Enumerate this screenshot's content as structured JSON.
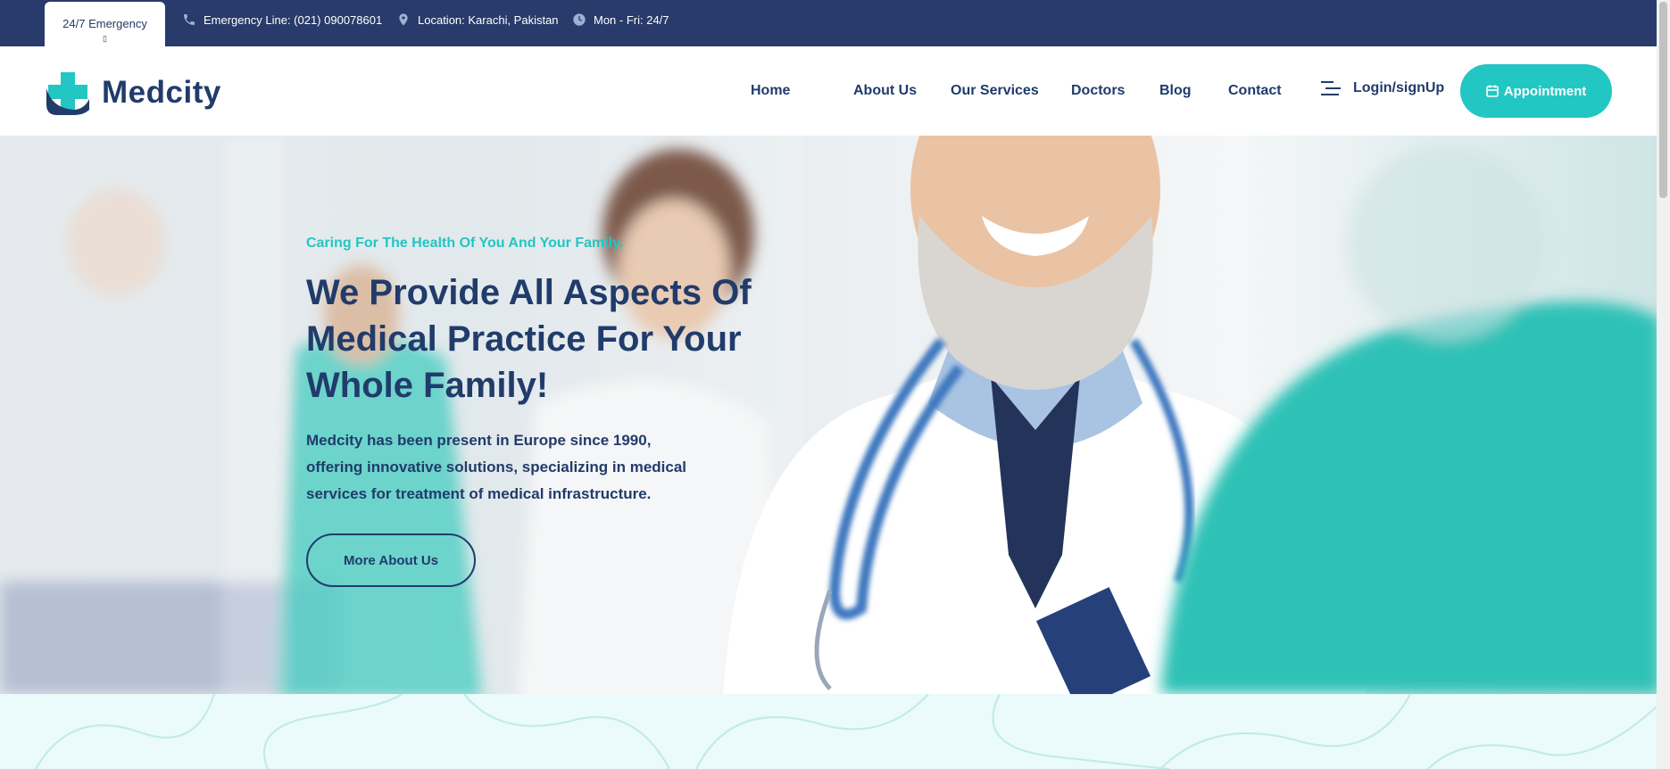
{
  "topbar": {
    "emergency_tab": "24/7 Emergency",
    "emergency_tab_glyph": "▯",
    "emergency_line": "Emergency Line: (021) 090078601",
    "location": "Location: Karachi, Pakistan",
    "hours": "Mon - Fri: 24/7"
  },
  "header": {
    "logo_text": "Medcity",
    "nav": [
      "Home",
      "About Us",
      "Our Services",
      "Doctors",
      "Blog",
      "Contact"
    ],
    "login_label": "Login/signUp",
    "appointment_label": "Appointment"
  },
  "hero": {
    "tagline": "Caring For The Health Of You And Your Family.",
    "title": "We Provide All Aspects Of Medical Practice For Your Whole Family!",
    "description": "Medcity has been present in Europe since 1990, offering innovative solutions, specializing in medical services for treatment of medical infrastructure.",
    "button_label": "More About Us"
  },
  "colors": {
    "navy": "#213b6b",
    "topbar": "#283b6a",
    "accent": "#22c6c3",
    "section_bg": "#ebfafa"
  },
  "icons": {
    "phone": "phone-icon",
    "location": "location-pin-icon",
    "clock": "clock-icon",
    "menu": "menu-lines-icon",
    "calendar": "calendar-icon",
    "logo": "medical-cross-logo-icon"
  }
}
